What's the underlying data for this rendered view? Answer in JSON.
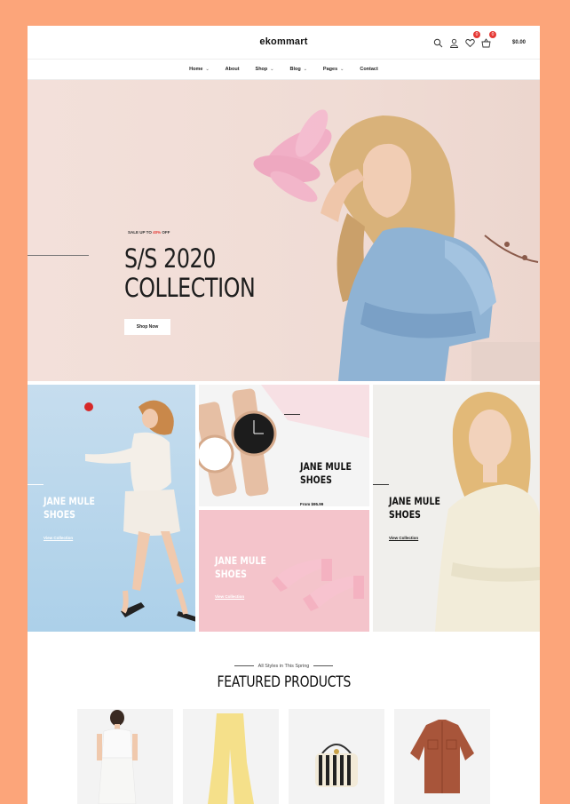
{
  "header": {
    "logo": "ekommart",
    "wishlist_count": "0",
    "cart_count": "0",
    "cart_total": "$0.00"
  },
  "icons": [
    "search-icon",
    "user-icon",
    "heart-icon",
    "basket-icon"
  ],
  "nav": [
    {
      "label": "Home",
      "has_dropdown": true
    },
    {
      "label": "About",
      "has_dropdown": false
    },
    {
      "label": "Shop",
      "has_dropdown": true
    },
    {
      "label": "Blog",
      "has_dropdown": true
    },
    {
      "label": "Pages",
      "has_dropdown": true
    },
    {
      "label": "Contact",
      "has_dropdown": false
    }
  ],
  "hero": {
    "sale_prefix": "SALE UP TO ",
    "sale_percent": "40%",
    "sale_suffix": " OFF",
    "title_line1": "S/S 2020",
    "title_line2": "COLLECTION",
    "button": "Shop Now"
  },
  "banners": [
    {
      "title1": "JANE MULE",
      "title2": "SHOES",
      "link": "View Collection"
    },
    {
      "title1": "JANE MULE",
      "title2": "SHOES",
      "link": "From $95.99"
    },
    {
      "title1": "JANE MULE",
      "title2": "SHOES",
      "link": "View Collection"
    },
    {
      "title1": "JANE MULE",
      "title2": "SHOES",
      "link": "View Collection"
    }
  ],
  "featured": {
    "subtitle": "All Styles in This Spring",
    "title": "FEATURED PRODUCTS"
  },
  "colors": {
    "frame": "#fca57a",
    "accent": "#e53935",
    "hero_bg": "#f0dcd5"
  }
}
